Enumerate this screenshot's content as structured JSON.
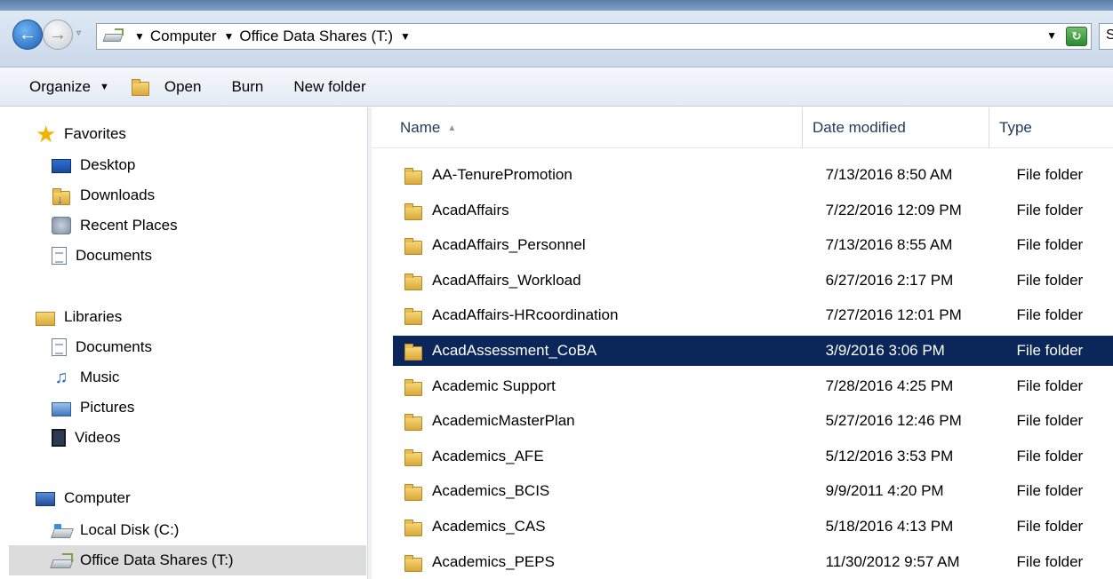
{
  "address": {
    "crumbs": [
      "Computer",
      "Office Data Shares (T:)"
    ],
    "search_partial": "S"
  },
  "toolbar": {
    "organize": "Organize",
    "open": "Open",
    "burn": "Burn",
    "new_folder": "New folder"
  },
  "nav": {
    "favorites": "Favorites",
    "desktop": "Desktop",
    "downloads": "Downloads",
    "recent": "Recent Places",
    "fav_documents": "Documents",
    "libraries": "Libraries",
    "lib_documents": "Documents",
    "music": "Music",
    "pictures": "Pictures",
    "videos": "Videos",
    "computer": "Computer",
    "local_disk": "Local Disk (C:)",
    "office_share": "Office Data Shares (T:)"
  },
  "columns": {
    "name": "Name",
    "date": "Date modified",
    "type": "Type"
  },
  "files": [
    {
      "name": "AA-TenurePromotion",
      "date": "7/13/2016 8:50 AM",
      "type": "File folder"
    },
    {
      "name": "AcadAffairs",
      "date": "7/22/2016 12:09 PM",
      "type": "File folder"
    },
    {
      "name": "AcadAffairs_Personnel",
      "date": "7/13/2016 8:55 AM",
      "type": "File folder"
    },
    {
      "name": "AcadAffairs_Workload",
      "date": "6/27/2016 2:17 PM",
      "type": "File folder"
    },
    {
      "name": "AcadAffairs-HRcoordination",
      "date": "7/27/2016 12:01 PM",
      "type": "File folder"
    },
    {
      "name": "AcadAssessment_CoBA",
      "date": "3/9/2016 3:06 PM",
      "type": "File folder"
    },
    {
      "name": "Academic Support",
      "date": "7/28/2016 4:25 PM",
      "type": "File folder"
    },
    {
      "name": "AcademicMasterPlan",
      "date": "5/27/2016 12:46 PM",
      "type": "File folder"
    },
    {
      "name": "Academics_AFE",
      "date": "5/12/2016 3:53 PM",
      "type": "File folder"
    },
    {
      "name": "Academics_BCIS",
      "date": "9/9/2011 4:20 PM",
      "type": "File folder"
    },
    {
      "name": "Academics_CAS",
      "date": "5/18/2016 4:13 PM",
      "type": "File folder"
    },
    {
      "name": "Academics_PEPS",
      "date": "11/30/2012 9:57 AM",
      "type": "File folder"
    }
  ],
  "selected_file": "AcadAssessment_CoBA",
  "colors": {
    "selection": "#0b2659",
    "nav_selected": "#dcdcdc",
    "header_text": "#1e395b"
  }
}
